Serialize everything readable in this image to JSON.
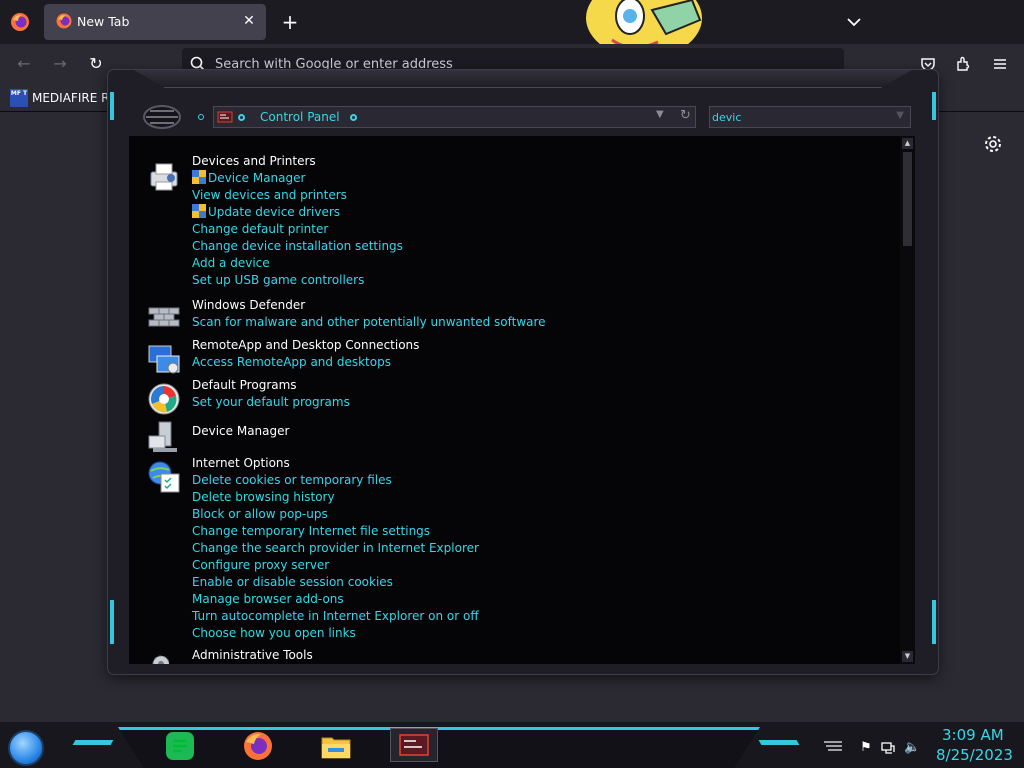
{
  "browser": {
    "tab_title": "New Tab",
    "new_tab_label": "+",
    "address_placeholder": "Search with Google or enter address",
    "bookmark_icon_text": "MF T",
    "bookmark_label": "MEDIAFIRE RO"
  },
  "control_panel": {
    "breadcrumb": "Control Panel",
    "search_value": "devic",
    "groups": [
      {
        "title": "Devices and Printers",
        "icon": "printer-icon",
        "tasks": [
          {
            "label": "Device Manager",
            "shield": true
          },
          {
            "label": "View devices and printers",
            "shield": false
          },
          {
            "label": "Update device drivers",
            "shield": true
          },
          {
            "label": "Change default printer",
            "shield": false
          },
          {
            "label": "Change device installation settings",
            "shield": false
          },
          {
            "label": "Add a device",
            "shield": false
          },
          {
            "label": "Set up USB game controllers",
            "shield": false
          }
        ]
      },
      {
        "title": "Windows Defender",
        "icon": "defender-wall-icon",
        "tasks": [
          {
            "label": "Scan for malware and other potentially unwanted software",
            "shield": false
          }
        ]
      },
      {
        "title": "RemoteApp and Desktop Connections",
        "icon": "remoteapp-icon",
        "tasks": [
          {
            "label": "Access RemoteApp and desktops",
            "shield": false
          }
        ]
      },
      {
        "title": "Default Programs",
        "icon": "default-programs-icon",
        "tasks": [
          {
            "label": "Set your default programs",
            "shield": false
          }
        ]
      },
      {
        "title": "Device Manager",
        "icon": "device-manager-icon",
        "tasks": []
      },
      {
        "title": "Internet Options",
        "icon": "internet-options-icon",
        "tasks": [
          {
            "label": "Delete cookies or temporary files",
            "shield": false
          },
          {
            "label": "Delete browsing history",
            "shield": false
          },
          {
            "label": "Block or allow pop-ups",
            "shield": false
          },
          {
            "label": "Change temporary Internet file settings",
            "shield": false
          },
          {
            "label": "Change the search provider in Internet Explorer",
            "shield": false
          },
          {
            "label": "Configure proxy server",
            "shield": false
          },
          {
            "label": "Enable or disable session cookies",
            "shield": false
          },
          {
            "label": "Manage browser add-ons",
            "shield": false
          },
          {
            "label": "Turn autocomplete in Internet Explorer on or off",
            "shield": false
          },
          {
            "label": "Choose how you open links",
            "shield": false
          }
        ]
      },
      {
        "title": "Administrative Tools",
        "icon": "admin-tools-icon",
        "tasks": []
      }
    ]
  },
  "taskbar": {
    "apps": [
      "notes-app-icon",
      "firefox-icon",
      "file-explorer-icon",
      "control-panel-icon"
    ],
    "time": "3:09 AM",
    "date": "8/25/2023"
  },
  "colors": {
    "accent": "#38d6e6",
    "link": "#38d6e6",
    "content_bg": "#050407"
  }
}
